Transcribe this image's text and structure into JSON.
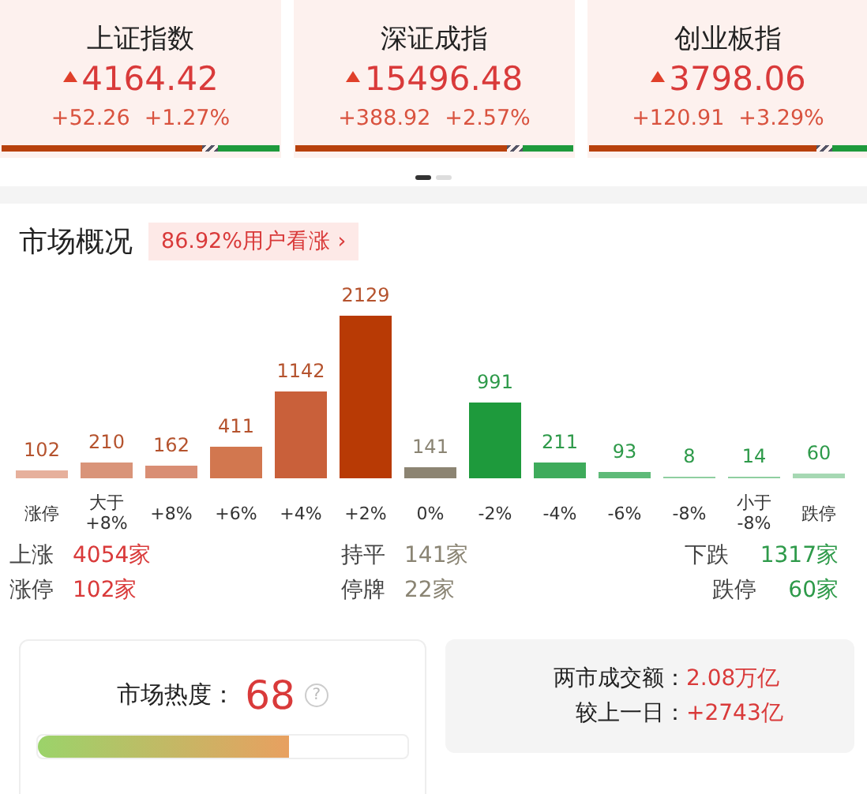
{
  "indices": [
    {
      "name": "上证指数",
      "price": "4164.42",
      "change": "+52.26",
      "percent": "+1.27%",
      "up": true,
      "level": 0.72
    },
    {
      "name": "深证成指",
      "price": "15496.48",
      "change": "+388.92",
      "percent": "+2.57%",
      "up": true,
      "level": 0.76
    },
    {
      "name": "创业板指",
      "price": "3798.06",
      "change": "+120.91",
      "percent": "+3.29%",
      "up": true,
      "level": 0.82
    }
  ],
  "pager": [
    {
      "selected": true
    },
    {
      "selected": false
    }
  ],
  "overview": {
    "title": "市场概况",
    "sentiment": "86.92%用户看涨",
    "sentiment_arrow": "›",
    "chart_data": {
      "type": "bar",
      "categories": [
        "涨停",
        "大于\n+8%",
        "+8%",
        "+6%",
        "+4%",
        "+2%",
        "0%",
        "-2%",
        "-4%",
        "-6%",
        "-8%",
        "小于\n-8%",
        "跌停"
      ],
      "series": [
        {
          "values": [
            102,
            210,
            162,
            411,
            1142,
            2129,
            141,
            991,
            211,
            93,
            8,
            14,
            60
          ]
        }
      ],
      "colors": [
        "#e6b09c",
        "#d99479",
        "#d98e74",
        "#d2774f",
        "#c9603a",
        "#b83a05",
        "#8c8472",
        "#1e9a3c",
        "#3eab5b",
        "#5eba78",
        "#8fcfa0",
        "#8fcfa0",
        "#a6d8b3"
      ],
      "data_labels": true
    },
    "stats": [
      {
        "label": "上涨",
        "value": "4054家",
        "kind": "up"
      },
      {
        "label": "持平",
        "value": "141家",
        "kind": "flat"
      },
      {
        "label": "下跌",
        "value": "1317家",
        "kind": "down"
      },
      {
        "label": "涨停",
        "value": "102家",
        "kind": "up"
      },
      {
        "label": "停牌",
        "value": "22家",
        "kind": "flat"
      },
      {
        "label": "跌停",
        "value": "60家",
        "kind": "down"
      }
    ]
  },
  "heat": {
    "label": "市场热度：",
    "value": "68",
    "help": "?",
    "level": 0.68
  },
  "turnover": [
    {
      "label": "两市成交额：",
      "value": "2.08万亿"
    },
    {
      "label": "较上一日：",
      "value": "+2743亿"
    }
  ]
}
